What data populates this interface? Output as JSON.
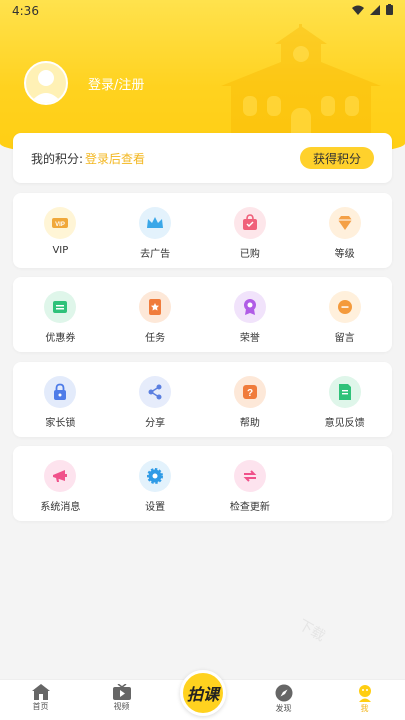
{
  "status": {
    "time": "4:36"
  },
  "profile": {
    "login_text": "登录/注册"
  },
  "points": {
    "label": "我的积分:",
    "value": "登录后查看",
    "button": "获得积分"
  },
  "grid_rows": [
    [
      {
        "label": "VIP",
        "icon": "vip-icon",
        "bg": "#fff5d6",
        "color": "#f0a83a"
      },
      {
        "label": "去广告",
        "icon": "crown-icon",
        "bg": "#e3f2fc",
        "color": "#3aa7e8"
      },
      {
        "label": "已购",
        "icon": "bag-icon",
        "bg": "#fde6ea",
        "color": "#f0607a"
      },
      {
        "label": "等级",
        "icon": "diamond-icon",
        "bg": "#fff0dc",
        "color": "#f4a046"
      }
    ],
    [
      {
        "label": "优惠券",
        "icon": "coupon-icon",
        "bg": "#dff6ea",
        "color": "#2fc27a"
      },
      {
        "label": "任务",
        "icon": "task-icon",
        "bg": "#fde8d8",
        "color": "#f07c3c"
      },
      {
        "label": "荣誉",
        "icon": "medal-icon",
        "bg": "#f1e3fb",
        "color": "#b05ce6"
      },
      {
        "label": "留言",
        "icon": "message-icon",
        "bg": "#fff0dc",
        "color": "#f49a3c"
      }
    ],
    [
      {
        "label": "家长锁",
        "icon": "lock-icon",
        "bg": "#e3ebfb",
        "color": "#4d7be8"
      },
      {
        "label": "分享",
        "icon": "share-icon",
        "bg": "#e6ecfb",
        "color": "#5b7fe0"
      },
      {
        "label": "帮助",
        "icon": "help-icon",
        "bg": "#fde8d8",
        "color": "#f07c3c"
      },
      {
        "label": "意见反馈",
        "icon": "feedback-icon",
        "bg": "#dff6ea",
        "color": "#2fc27a"
      }
    ],
    [
      {
        "label": "系统消息",
        "icon": "bell-icon",
        "bg": "#fde3ee",
        "color": "#f0508a"
      },
      {
        "label": "设置",
        "icon": "gear-icon",
        "bg": "#e3f2fc",
        "color": "#2f9be6"
      },
      {
        "label": "检查更新",
        "icon": "refresh-icon",
        "bg": "#fde3ee",
        "color": "#f0508a"
      }
    ]
  ],
  "nav": [
    {
      "label": "首页",
      "icon": "home-icon"
    },
    {
      "label": "视频",
      "icon": "video-icon"
    },
    {
      "label": "",
      "icon": "center-logo"
    },
    {
      "label": "发现",
      "icon": "compass-icon"
    },
    {
      "label": "我",
      "icon": "me-icon",
      "active": true
    }
  ],
  "center_logo_text": "拍课",
  "watermark": "下载"
}
